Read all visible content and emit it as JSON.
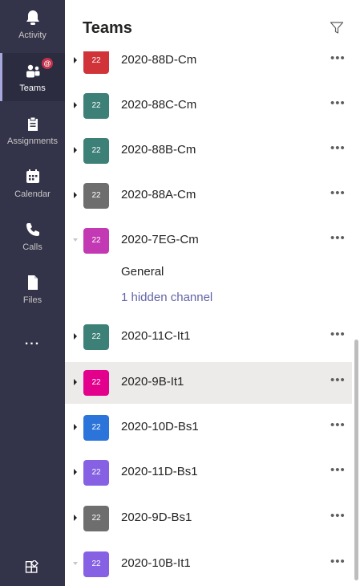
{
  "rail": {
    "items": [
      {
        "label": "Activity",
        "icon": "bell-icon"
      },
      {
        "label": "Teams",
        "icon": "teams-icon",
        "active": true,
        "badge": "@"
      },
      {
        "label": "Assignments",
        "icon": "assignments-icon"
      },
      {
        "label": "Calendar",
        "icon": "calendar-icon"
      },
      {
        "label": "Calls",
        "icon": "phone-icon"
      },
      {
        "label": "Files",
        "icon": "file-icon"
      }
    ],
    "more": "...",
    "apps_icon": "apps-icon"
  },
  "header": {
    "title": "Teams",
    "filter_icon": "filter-icon"
  },
  "teams": [
    {
      "name": "2020-88D-Cm",
      "tile": "22",
      "color": "#d13438",
      "expanded": false
    },
    {
      "name": "2020-88C-Cm",
      "tile": "22",
      "color": "#3d8078",
      "expanded": false
    },
    {
      "name": "2020-88B-Cm",
      "tile": "22",
      "color": "#3d8078",
      "expanded": false
    },
    {
      "name": "2020-88A-Cm",
      "tile": "22",
      "color": "#6e6e6e",
      "expanded": false
    },
    {
      "name": "2020-7EG-Cm",
      "tile": "22",
      "color": "#c239b3",
      "expanded": true
    },
    {
      "name": "2020-11C-It1",
      "tile": "22",
      "color": "#3d8078",
      "expanded": false
    },
    {
      "name": "2020-9B-It1",
      "tile": "22",
      "color": "#e3008c",
      "expanded": false,
      "selected": true
    },
    {
      "name": "2020-10D-Bs1",
      "tile": "22",
      "color": "#2b74d9",
      "expanded": false
    },
    {
      "name": "2020-11D-Bs1",
      "tile": "22",
      "color": "#8661e3",
      "expanded": false
    },
    {
      "name": "2020-9D-Bs1",
      "tile": "22",
      "color": "#6e6e6e",
      "expanded": false
    },
    {
      "name": "2020-10B-It1",
      "tile": "22",
      "color": "#8661e3",
      "expanded": true
    }
  ],
  "channels": {
    "general": "General",
    "hidden": "1 hidden channel"
  },
  "more_label": "•••",
  "colors": {
    "rail_bg": "#33344a",
    "link": "#6264a7",
    "selected_row": "#edebe9"
  }
}
